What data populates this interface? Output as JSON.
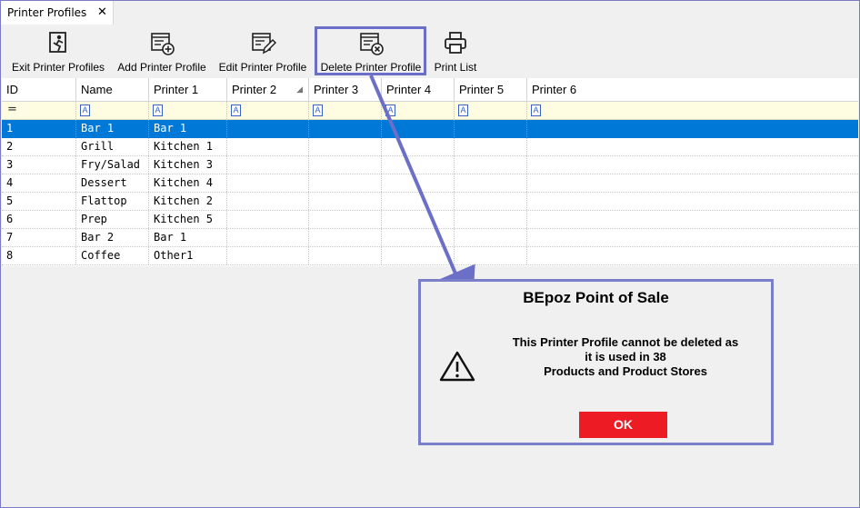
{
  "tab": {
    "label": "Printer Profiles",
    "close_glyph": "✕"
  },
  "toolbar": {
    "exit_label": "Exit Printer Profiles",
    "add_label": "Add Printer Profile",
    "edit_label": "Edit Printer Profile",
    "delete_label": "Delete Printer Profile",
    "print_label": "Print List"
  },
  "grid": {
    "columns": [
      "ID",
      "Name",
      "Printer 1",
      "Printer 2",
      "Printer 3",
      "Printer 4",
      "Printer 5",
      "Printer 6"
    ],
    "filter_eq": "=",
    "filter_icon": "A",
    "selected_row": 0,
    "rows": [
      {
        "id": "1",
        "name": "Bar 1",
        "p1": "Bar 1"
      },
      {
        "id": "2",
        "name": "Grill",
        "p1": "Kitchen 1"
      },
      {
        "id": "3",
        "name": "Fry/Salad",
        "p1": "Kitchen 3"
      },
      {
        "id": "4",
        "name": "Dessert",
        "p1": "Kitchen 4"
      },
      {
        "id": "5",
        "name": "Flattop",
        "p1": "Kitchen 2"
      },
      {
        "id": "6",
        "name": "Prep",
        "p1": "Kitchen 5"
      },
      {
        "id": "7",
        "name": "Bar 2",
        "p1": "Bar 1"
      },
      {
        "id": "8",
        "name": "Coffee",
        "p1": "Other1"
      }
    ]
  },
  "dialog": {
    "title": "BEpoz Point of Sale",
    "message_lines": [
      "This Printer Profile cannot be deleted as",
      "it is used in 38",
      "Products and Product Stores"
    ],
    "ok_label": "OK"
  },
  "colors": {
    "selection": "#0078d7",
    "highlight_border": "#6b6fc8",
    "ok_button": "#ed1c24",
    "filter_row": "#fffde1"
  }
}
